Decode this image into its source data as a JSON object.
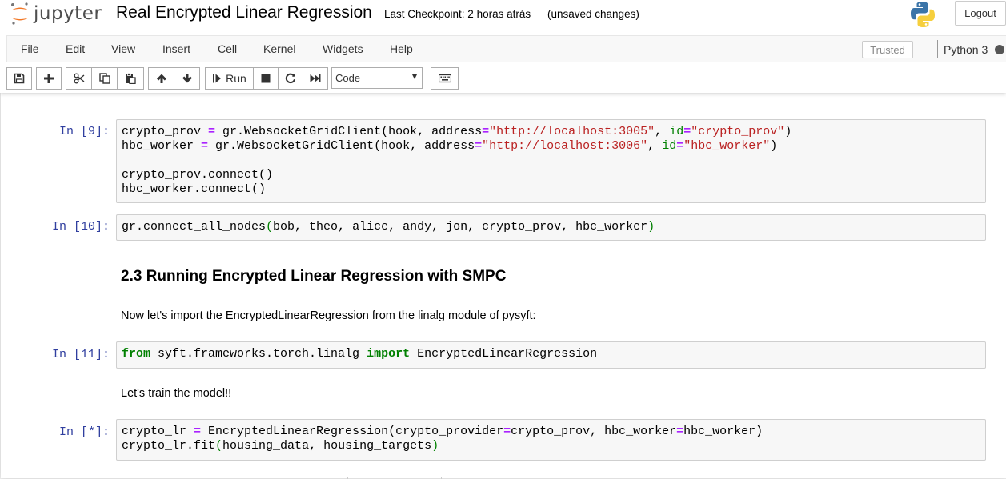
{
  "app": {
    "logo_text": "jupyter",
    "notebook_title": "Real Encrypted Linear Regression",
    "checkpoint": "Last Checkpoint: 2 horas atrás",
    "autosave_status": "(unsaved changes)",
    "logout_label": "Logout"
  },
  "menu": {
    "items": [
      "File",
      "Edit",
      "View",
      "Insert",
      "Cell",
      "Kernel",
      "Widgets",
      "Help"
    ],
    "trusted_label": "Trusted",
    "kernel_name": "Python 3"
  },
  "toolbar": {
    "run_label": "Run",
    "cell_type": "Code",
    "icons": [
      "save-icon",
      "plus-icon",
      "cut-icon",
      "copy-icon",
      "paste-icon",
      "arrow-up-icon",
      "arrow-down-icon",
      "run-icon",
      "stop-icon",
      "restart-icon",
      "fast-forward-icon",
      "keyboard-icon"
    ]
  },
  "cells": {
    "c9": {
      "prompt": "In [9]:"
    },
    "c10": {
      "prompt": "In [10]:"
    },
    "h23": {
      "text": "2.3 Running Encrypted Linear Regression with SMPC"
    },
    "p1": {
      "text": "Now let's import the EncryptedLinearRegression from the linalg module of pysyft:"
    },
    "c11": {
      "prompt": "In [11]:"
    },
    "p2": {
      "text": "Let's train the model!!"
    },
    "cstar": {
      "prompt": "In [*]:"
    }
  },
  "code": {
    "c9_l1": {
      "a": "crypto_prov ",
      "op1": "=",
      "b": " gr.WebsocketGridClient(hook, address",
      "op2": "=",
      "s1": "\"http://localhost:3005\"",
      "c": ", ",
      "k": "id",
      "op3": "=",
      "s2": "\"crypto_prov\"",
      "d": ")"
    },
    "c9_l2": {
      "a": "hbc_worker ",
      "op1": "=",
      "b": " gr.WebsocketGridClient(hook, address",
      "op2": "=",
      "s1": "\"http://localhost:3006\"",
      "c": ", ",
      "k": "id",
      "op3": "=",
      "s2": "\"hbc_worker\"",
      "d": ")"
    },
    "c9_l3": "crypto_prov.connect()",
    "c9_l4": "hbc_worker.connect()",
    "c10_l1": {
      "a": "gr.connect_all_nodes",
      "p1": "(",
      "b": "bob, theo, alice, andy, jon, crypto_prov, hbc_worker",
      "p2": ")"
    },
    "c11_l1": {
      "kw1": "from",
      "a": " syft.frameworks.torch.linalg ",
      "kw2": "import",
      "b": " EncryptedLinearRegression"
    },
    "cs_l1": {
      "a": "crypto_lr ",
      "op1": "=",
      "b": " EncryptedLinearRegression(crypto_provider",
      "op2": "=",
      "c": "crypto_prov, hbc_worker",
      "op3": "=",
      "d": "hbc_worker)"
    },
    "cs_l2": {
      "a": "crypto_lr.fit",
      "p1": "(",
      "b": "housing_data, housing_targets",
      "p2": ")"
    }
  }
}
